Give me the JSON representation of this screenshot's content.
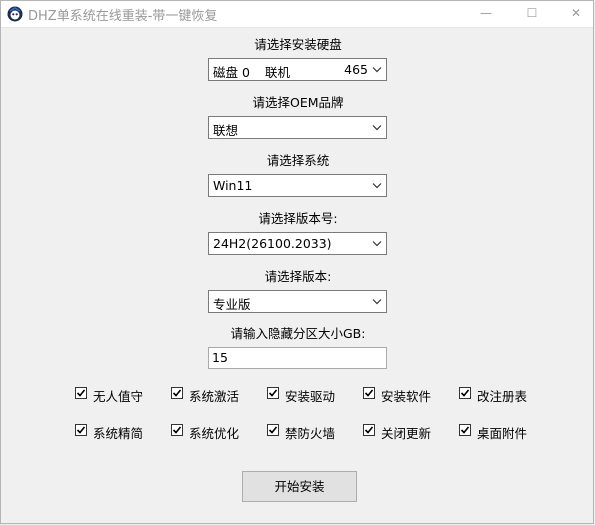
{
  "window": {
    "title": "DHZ单系统在线重装-带一键恢复",
    "minimize_glyph": "—",
    "maximize_glyph": "☐",
    "close_glyph": "✕"
  },
  "form": {
    "disk": {
      "label": "请选择安装硬盘",
      "value_disk": "磁盘 0",
      "value_brand": "联机",
      "value_size": "465"
    },
    "oem": {
      "label": "请选择OEM品牌",
      "value": "联想"
    },
    "system": {
      "label": "请选择系统",
      "value": "Win11"
    },
    "version_number": {
      "label": "请选择版本号:",
      "value": "24H2(26100.2033)"
    },
    "edition": {
      "label": "请选择版本:",
      "value": "专业版"
    },
    "hidden_partition": {
      "label": "请输入隐藏分区大小GB:",
      "value": "15"
    }
  },
  "options": [
    {
      "label": "无人值守",
      "checked": true
    },
    {
      "label": "系统激活",
      "checked": true
    },
    {
      "label": "安装驱动",
      "checked": true
    },
    {
      "label": "安装软件",
      "checked": true
    },
    {
      "label": "改注册表",
      "checked": true
    },
    {
      "label": "系统精简",
      "checked": true
    },
    {
      "label": "系统优化",
      "checked": true
    },
    {
      "label": "禁防火墙",
      "checked": true
    },
    {
      "label": "关闭更新",
      "checked": true
    },
    {
      "label": "桌面附件",
      "checked": true
    }
  ],
  "actions": {
    "start_label": "开始安装"
  },
  "icons": {
    "app": "app-logo-icon",
    "dropdown": "chevron-down-icon",
    "check": "checkmark-icon"
  }
}
